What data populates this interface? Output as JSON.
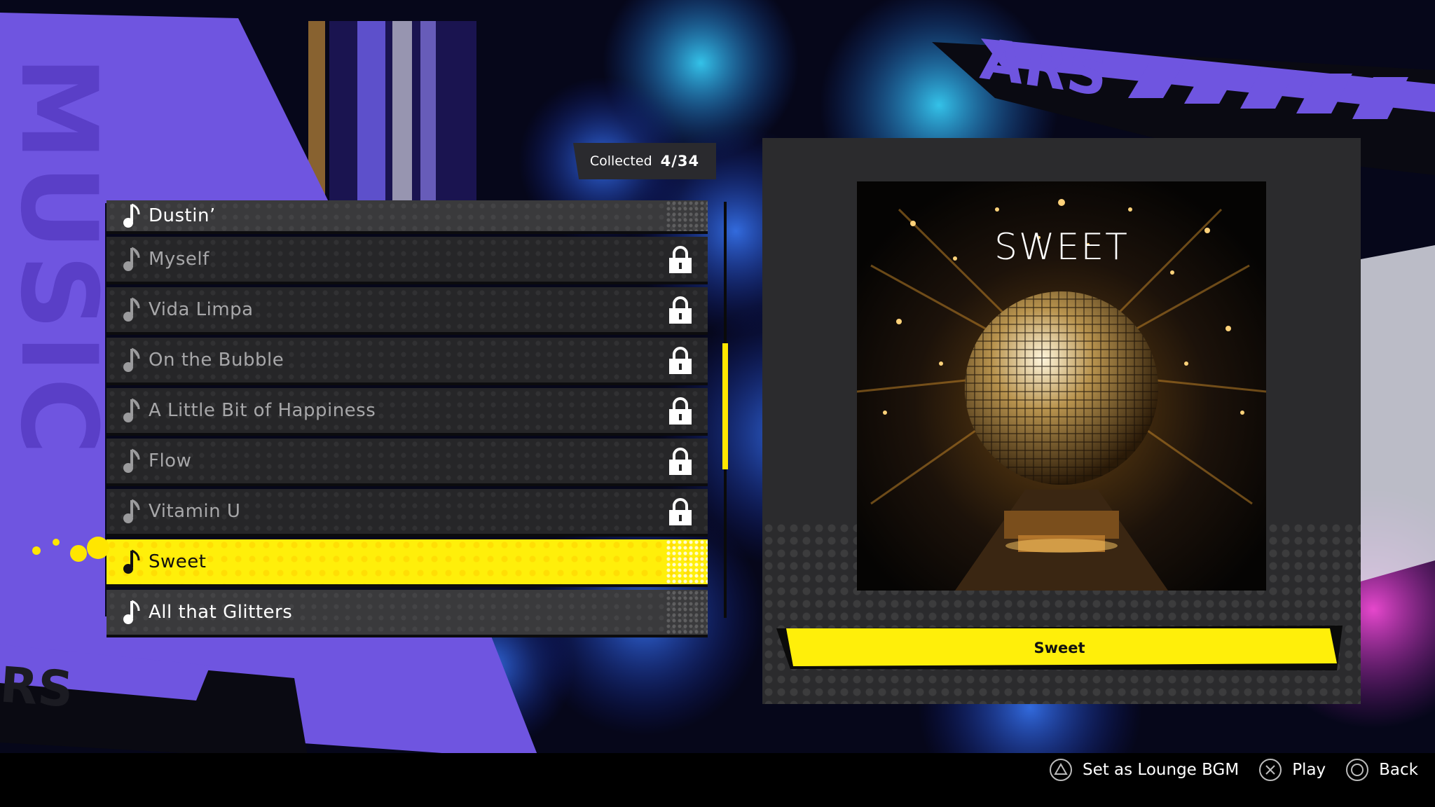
{
  "screen": {
    "title_word": "MUSIC",
    "brand_word_top": "ARS",
    "brand_word_bottom": "RS",
    "accent_yellow": "#ffef0a",
    "accent_purple": "#6f55e0"
  },
  "collection": {
    "label": "Collected",
    "count": "4/34"
  },
  "songs": [
    {
      "title": "Dustin’",
      "locked": false
    },
    {
      "title": "Myself",
      "locked": true
    },
    {
      "title": "Vida Limpa",
      "locked": true
    },
    {
      "title": "On the Bubble",
      "locked": true
    },
    {
      "title": "A Little Bit of Happiness",
      "locked": true
    },
    {
      "title": "Flow",
      "locked": true
    },
    {
      "title": "Vitamin U",
      "locked": true
    },
    {
      "title": "Sweet",
      "locked": false,
      "selected": true
    },
    {
      "title": "All that Glitters",
      "locked": false
    }
  ],
  "selected_song": {
    "art_title": "SWEET",
    "name": "Sweet"
  },
  "footer": {
    "lounge_label": "Set as Lounge BGM",
    "play_label": "Play",
    "back_label": "Back",
    "lounge_icon": "triangle-button-icon",
    "play_icon": "cross-button-icon",
    "back_icon": "circle-button-icon"
  }
}
